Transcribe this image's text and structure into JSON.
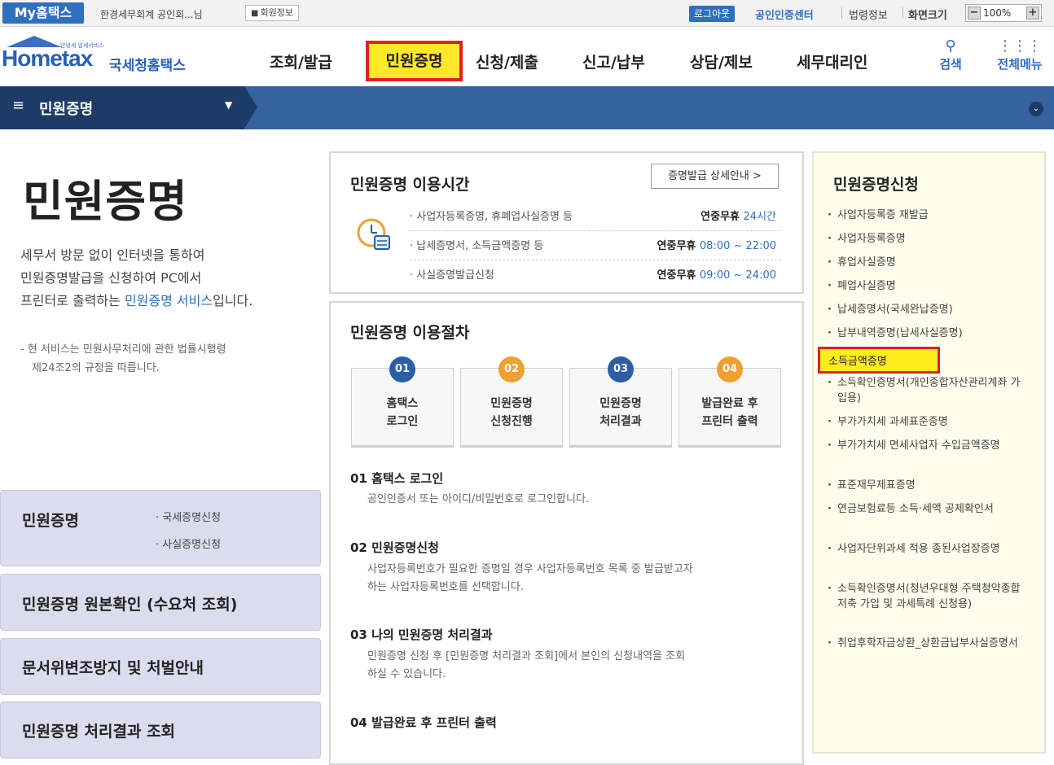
{
  "topbar": {
    "my_hometax": "My홈택스",
    "user_greeting": "한경세무회계 공인회...님",
    "member_info": "회원정보",
    "logout": "로그아웃",
    "cert_center": "공인인증센터",
    "law_info": "법령정보",
    "screen_size": "화면크기",
    "zoom_value": "100%"
  },
  "header": {
    "logo_small": "안녕세 알세서비스",
    "logo_word": "Hometax",
    "logo_kr": "국세청홈택스",
    "gnb": [
      "조회/발급",
      "민원증명",
      "신청/제출",
      "신고/납부",
      "상담/제보",
      "세무대리인"
    ],
    "active_gnb": "민원증명",
    "search_label": "검색",
    "all_menu_label": "전체메뉴"
  },
  "navbar": {
    "title": "민원증명"
  },
  "left": {
    "page_title": "민원증명",
    "intro_line1": "세무서 방문 없이 인터넷을 통하여",
    "intro_line2": "민원증명발급을 신청하여 PC에서",
    "intro_line3_pre": "프린터로 출력하는 ",
    "intro_line3_link": "민원증명 서비스",
    "intro_line3_post": "입니다.",
    "law_note_line1": "- 현 서비스는 민원사무처리에 관한 법률시행령",
    "law_note_line2": "제24조2의 규정을 따릅니다.",
    "boxes": {
      "box1_title": "민원증명",
      "box1_sub1": "· 국세증명신청",
      "box1_sub2": "· 사실증명신청",
      "box2_title": "민원증명 원본확인 (수요처 조회)",
      "box3_title": "문서위변조방지 및 처벌안내",
      "box4_title": "민원증명 처리결과 조회"
    }
  },
  "hours": {
    "title": "민원증명 이용시간",
    "guide_button": "증명발급 상세안내 >",
    "rows": [
      {
        "name": "· 사업자등록증명, 휴폐업사실증명 등",
        "prefix": "연중무휴 ",
        "time": "24시간"
      },
      {
        "name": "· 납세증명서, 소득금액증명 등",
        "prefix": "연중무휴 ",
        "time": "08:00 ~ 22:00"
      },
      {
        "name": "· 사실증명발급신청",
        "prefix": "연중무휴 ",
        "time": "09:00 ~ 24:00"
      }
    ]
  },
  "procedure": {
    "title": "민원증명 이용절차",
    "steps": [
      {
        "num": "01",
        "line1": "홈택스",
        "line2": "로그인",
        "color": "#2b5da8"
      },
      {
        "num": "02",
        "line1": "민원증명",
        "line2": "신청진행",
        "color": "#f0a030"
      },
      {
        "num": "03",
        "line1": "민원증명",
        "line2": "처리결과",
        "color": "#2b5da8"
      },
      {
        "num": "04",
        "line1": "발급완료 후",
        "line2": "프린터 출력",
        "color": "#f0a030"
      }
    ],
    "desc": {
      "h1": "01 홈택스 로그인",
      "p1": "공인인증서 또는 아이디/비밀번호로 로그인합니다.",
      "h2": "02 민원증명신청",
      "p2a": "사업자등록번호가 필요한 증명일 경우 사업자등록번호 목록 중 발급받고자",
      "p2b": "하는 사업자등록번호를 선택합니다.",
      "h3": "03 나의 민원증명 처리결과",
      "p3a": "민원증명 신청 후 [민원증명 처리결과 조회]에서 본인의 신청내역을 조회",
      "p3b": "하실 수 있습니다.",
      "h4": "04 발급완료 후 프린터 출력"
    }
  },
  "right": {
    "title": "민원증명신청",
    "items": [
      "사업자등록증 재발급",
      "사업자등록증명",
      "휴업사실증명",
      "폐업사실증명",
      "납세증명서(국세완납증명)",
      "납부내역증명(납세사실증명)",
      "소득금액증명",
      "소득확인증명서(개인종합자산관리계좌 가입용)",
      "부가가치세 과세표준증명",
      "부가가치세 면세사업자 수입금액증명",
      "표준재무제표증명",
      "연금보험료등 소득·세액 공제확인서",
      "사업자단위과세 적용 종된사업장증명",
      "소득확인증명서(청년우대형 주택청약종합저축 가입 및 과세특례 신청용)",
      "취업후학자금상환_상환금납부사실증명서"
    ],
    "highlighted_item": "소득금액증명"
  },
  "colors": {
    "accent": "#2e6fbe",
    "nav_dark": "#1c3c67",
    "highlight": "#ffe82a",
    "highlight_border": "#e02020"
  }
}
